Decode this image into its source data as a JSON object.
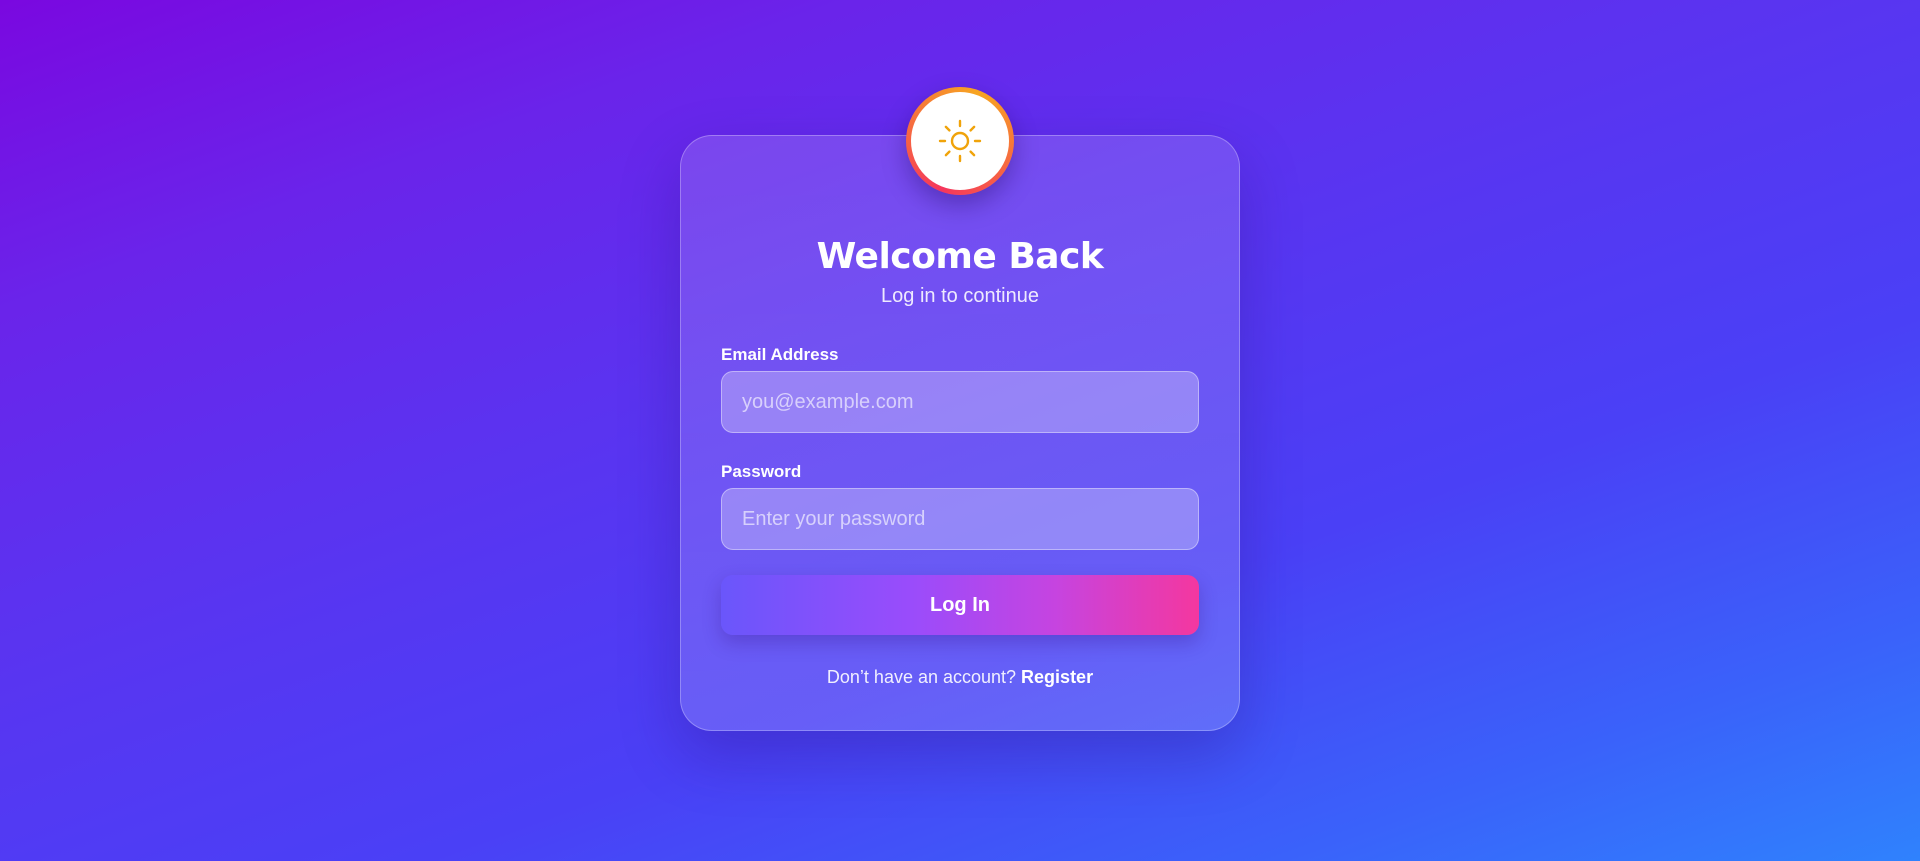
{
  "header": {
    "logo_icon": "sun-icon",
    "title": "Welcome Back",
    "subtitle": "Log in to continue"
  },
  "form": {
    "email_label": "Email Address",
    "email_placeholder": "you@example.com",
    "email_value": "",
    "password_label": "Password",
    "password_placeholder": "Enter your password",
    "password_value": "",
    "submit_label": "Log In"
  },
  "footer": {
    "prompt": "Don’t have an account? ",
    "register_link": "Register"
  },
  "colors": {
    "sun_icon": "#f0a30a",
    "logo_ring_start": "#f5365c",
    "logo_ring_end": "#f7a521",
    "button_gradient_start": "#6a56fb",
    "button_gradient_end": "#f4379f",
    "background_start": "#7a08e0",
    "background_end": "#2f82fd"
  }
}
